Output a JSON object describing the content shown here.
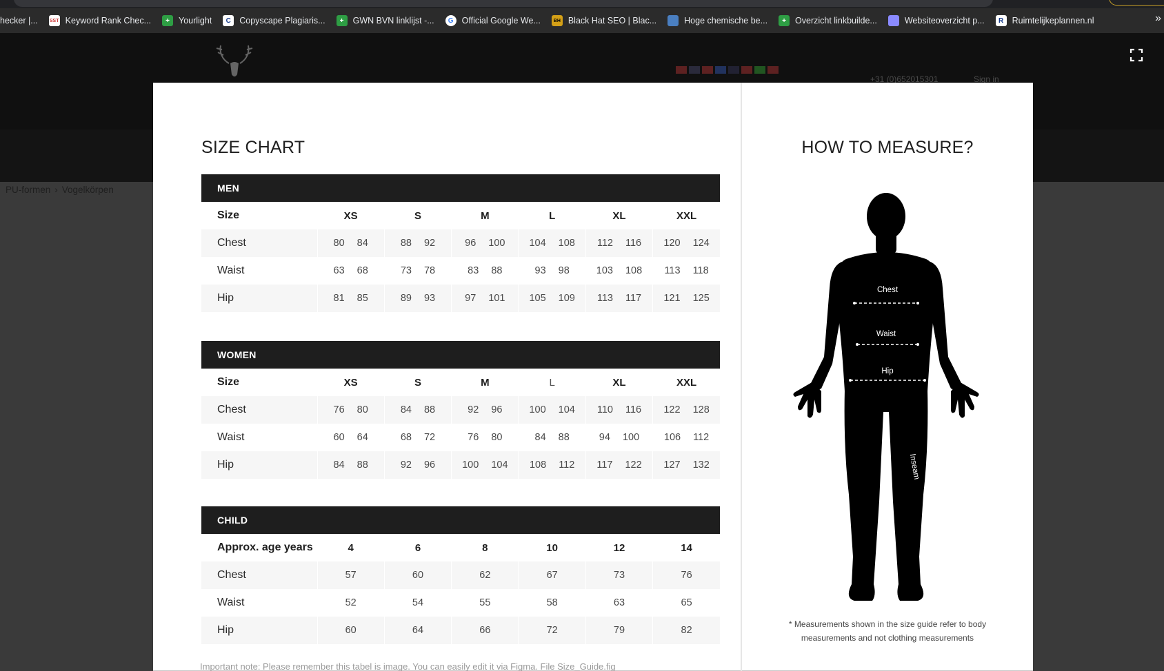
{
  "browser": {
    "bookmarks": [
      {
        "label": "hecker |...",
        "icon": "bookmark-icon",
        "color": "#2b2b2b"
      },
      {
        "label": "Keyword Rank Chec...",
        "icon": "sst-icon",
        "color": "#ffffff"
      },
      {
        "label": "Yourlight",
        "icon": "green-plus-icon",
        "color": "#2e9e44"
      },
      {
        "label": "Copyscape Plagiaris...",
        "icon": "copyscape-icon",
        "color": "#ffffff"
      },
      {
        "label": "GWN BVN linklijst -...",
        "icon": "green-plus-icon",
        "color": "#2e9e44"
      },
      {
        "label": "Official Google We...",
        "icon": "google-icon",
        "color": "#ffffff"
      },
      {
        "label": "Black Hat SEO | Blac...",
        "icon": "bhs-icon",
        "color": "#d4a017"
      },
      {
        "label": "Hoge chemische be...",
        "icon": "chart-icon",
        "color": "#4a7fc1"
      },
      {
        "label": "Overzicht linkbuilde...",
        "icon": "green-plus-icon",
        "color": "#2e9e44"
      },
      {
        "label": "Websiteoverzicht p...",
        "icon": "website-icon",
        "color": "#8a8aff"
      },
      {
        "label": "Ruimtelijkeplannen.nl",
        "icon": "r-icon",
        "color": "#ffffff"
      }
    ],
    "more": "»"
  },
  "site": {
    "phone": "+31 (0)652015301",
    "signin": "Sign in",
    "breadcrumb": [
      "PU-formen",
      "Vogelkörpen"
    ]
  },
  "modal": {
    "title": "SIZE CHART",
    "sections": [
      {
        "name": "MEN",
        "header_label": "Size",
        "columns": [
          "XS",
          "S",
          "M",
          "L",
          "XL",
          "XXL"
        ],
        "rows": [
          {
            "label": "Chest",
            "values": [
              [
                "80",
                "84"
              ],
              [
                "88",
                "92"
              ],
              [
                "96",
                "100"
              ],
              [
                "104",
                "108"
              ],
              [
                "112",
                "116"
              ],
              [
                "120",
                "124"
              ]
            ]
          },
          {
            "label": "Waist",
            "values": [
              [
                "63",
                "68"
              ],
              [
                "73",
                "78"
              ],
              [
                "83",
                "88"
              ],
              [
                "93",
                "98"
              ],
              [
                "103",
                "108"
              ],
              [
                "113",
                "118"
              ]
            ]
          },
          {
            "label": "Hip",
            "values": [
              [
                "81",
                "85"
              ],
              [
                "89",
                "93"
              ],
              [
                "97",
                "101"
              ],
              [
                "105",
                "109"
              ],
              [
                "113",
                "117"
              ],
              [
                "121",
                "125"
              ]
            ]
          }
        ]
      },
      {
        "name": "WOMEN",
        "header_label": "Size",
        "columns": [
          "XS",
          "S",
          "M",
          "L",
          "XL",
          "XXL"
        ],
        "rows": [
          {
            "label": "Chest",
            "values": [
              [
                "76",
                "80"
              ],
              [
                "84",
                "88"
              ],
              [
                "92",
                "96"
              ],
              [
                "100",
                "104"
              ],
              [
                "110",
                "116"
              ],
              [
                "122",
                "128"
              ]
            ]
          },
          {
            "label": "Waist",
            "values": [
              [
                "60",
                "64"
              ],
              [
                "68",
                "72"
              ],
              [
                "76",
                "80"
              ],
              [
                "84",
                "88"
              ],
              [
                "94",
                "100"
              ],
              [
                "106",
                "112"
              ]
            ]
          },
          {
            "label": "Hip",
            "values": [
              [
                "84",
                "88"
              ],
              [
                "92",
                "96"
              ],
              [
                "100",
                "104"
              ],
              [
                "108",
                "112"
              ],
              [
                "117",
                "122"
              ],
              [
                "127",
                "132"
              ]
            ]
          }
        ]
      },
      {
        "name": "CHILD",
        "header_label": "Approx. age years",
        "columns": [
          "4",
          "6",
          "8",
          "10",
          "12",
          "14"
        ],
        "rows": [
          {
            "label": "Chest",
            "values": [
              "57",
              "60",
              "62",
              "67",
              "73",
              "76"
            ]
          },
          {
            "label": "Waist",
            "values": [
              "52",
              "54",
              "55",
              "58",
              "63",
              "65"
            ]
          },
          {
            "label": "Hip",
            "values": [
              "60",
              "64",
              "66",
              "72",
              "79",
              "82"
            ]
          }
        ]
      }
    ],
    "note": "Important note: Please remember this tabel is image. You can easily edit it via Figma. File Size_Guide.fig",
    "measure": {
      "title": "HOW TO MEASURE?",
      "labels": {
        "chest": "Chest",
        "waist": "Waist",
        "hip": "Hip",
        "inseam": "Inseam"
      },
      "footnote": "* Measurements shown in the size guide refer to body measurements and not clothing measurements"
    }
  }
}
